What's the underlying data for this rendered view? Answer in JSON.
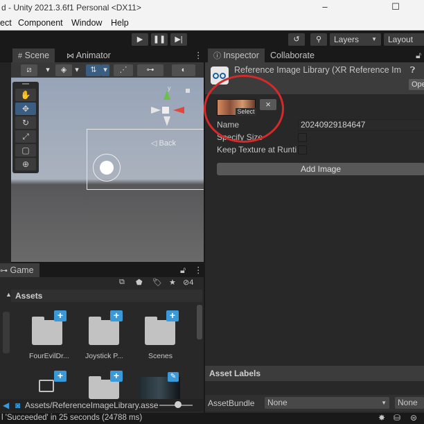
{
  "window": {
    "title": "d - Unity 2021.3.6f1 Personal <DX11>",
    "controls": [
      "–",
      "☐"
    ]
  },
  "menu": [
    "ect",
    "Component",
    "Window",
    "Help"
  ],
  "toolbar": {
    "play_icon": "play-icon",
    "pause_icon": "pause-icon",
    "step_icon": "step-icon",
    "layers_label": "Layers",
    "layout_label": "Layout"
  },
  "scene_panel": {
    "tabs": [
      "Scene",
      "Animator"
    ],
    "back_label": "◁ Back"
  },
  "game_panel": {
    "tab": "Game",
    "hidden_count": "4"
  },
  "project": {
    "assets_title": "Assets",
    "items": [
      {
        "label": "FourEvilDr..."
      },
      {
        "label": "Joystick P..."
      },
      {
        "label": "Scenes"
      },
      {
        "label": ""
      },
      {
        "label": ""
      },
      {
        "label": ""
      }
    ],
    "path": "Assets/ReferenceImageLibrary.asse"
  },
  "inspector": {
    "tabs": [
      "Inspector",
      "Collaborate"
    ],
    "title": "Reference Image Library (XR Reference Im",
    "open_label": "Ope",
    "select_label": "Select",
    "remove_icon": "×",
    "name_label": "Name",
    "name_value": "20240929184647",
    "specify_size_label": "Specify Size",
    "keep_texture_label": "Keep Texture at Runti",
    "add_image_label": "Add Image",
    "asset_labels": "Asset Labels",
    "assetbundle_label": "AssetBundle",
    "assetbundle_value": "None",
    "assetbundle_variant": "None"
  },
  "status": {
    "text": "l 'Succeeded' in 25 seconds (24788 ms)"
  },
  "colors": {
    "accent": "#3a9ad9",
    "highlight_circle": "#d42a2a"
  }
}
